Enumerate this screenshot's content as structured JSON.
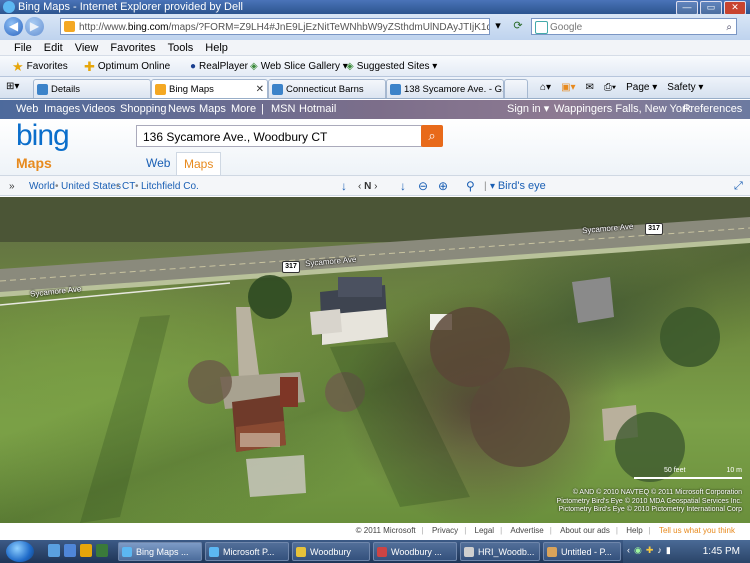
{
  "window": {
    "title": "Bing Maps - Internet Explorer provided by Dell",
    "buttons": {
      "minimize": "—",
      "maximize": "▭",
      "close": "✕"
    }
  },
  "address": {
    "url_prefix": "http://www.",
    "url_domain": "bing.com",
    "url_rest": "/maps/?FORM=Z9LH4#JnE9LjEzNitTeWNhbW9yZSthdmUlNDAyJTIjK1dvb2RidXJ",
    "search_placeholder": "Google"
  },
  "menu": [
    "File",
    "Edit",
    "View",
    "Favorites",
    "Tools",
    "Help"
  ],
  "favorites": {
    "favorites_label": "Favorites",
    "items": [
      "Optimum Online",
      "RealPlayer",
      "Web Slice Gallery ▾",
      "Suggested Sites ▾"
    ]
  },
  "tabs": [
    {
      "label": "Details"
    },
    {
      "label": "Bing Maps"
    },
    {
      "label": "Connecticut Barns"
    },
    {
      "label": "138 Sycamore Ave. - G..."
    }
  ],
  "commands": {
    "page": "Page ▾",
    "safety": "Safety ▾"
  },
  "bing": {
    "topnav": [
      "Web",
      "Images",
      "Videos",
      "Shopping",
      "News",
      "Maps",
      "More",
      "|",
      "MSN",
      "Hotmail"
    ],
    "signin": "Sign in ▾",
    "location": "Wappingers Falls, New York",
    "preferences": "Preferences",
    "logo": "bing",
    "logo_sub": "Maps",
    "query": "136 Sycamore Ave., Woodbury CT",
    "vtabs": [
      "Web",
      "Maps"
    ]
  },
  "maptool": {
    "breadcrumb": [
      "World",
      "United States",
      "CT",
      "Litchfield Co."
    ],
    "sep": "•",
    "birdseye": "Bird's eye",
    "compass": "N"
  },
  "map": {
    "road_labels": [
      "Sycamore Ave",
      "Sycamore Ave",
      "Sycamore Ave"
    ],
    "route_shields": [
      "317",
      "317"
    ],
    "scale": {
      "feet": "50 feet",
      "meters": "10 m"
    },
    "copyright": [
      "© AND  © 2010 NAVTEQ  © 2011 Microsoft Corporation",
      "Pictometry Bird's Eye © 2010 MDA Geospatial Services Inc.",
      "Pictometry Bird's Eye © 2010 Pictometry International Corp"
    ]
  },
  "footer": {
    "items": [
      "© 2011 Microsoft",
      "Privacy",
      "Legal",
      "Advertise",
      "About our ads",
      "Help"
    ],
    "tell": "Tell us what you think"
  },
  "taskbar": {
    "buttons": [
      "Bing Maps ...",
      "Microsoft P...",
      "Woodbury",
      "Woodbury ...",
      "HRI_Woodb...",
      "Untitled - P..."
    ],
    "clock": "1:45 PM"
  }
}
